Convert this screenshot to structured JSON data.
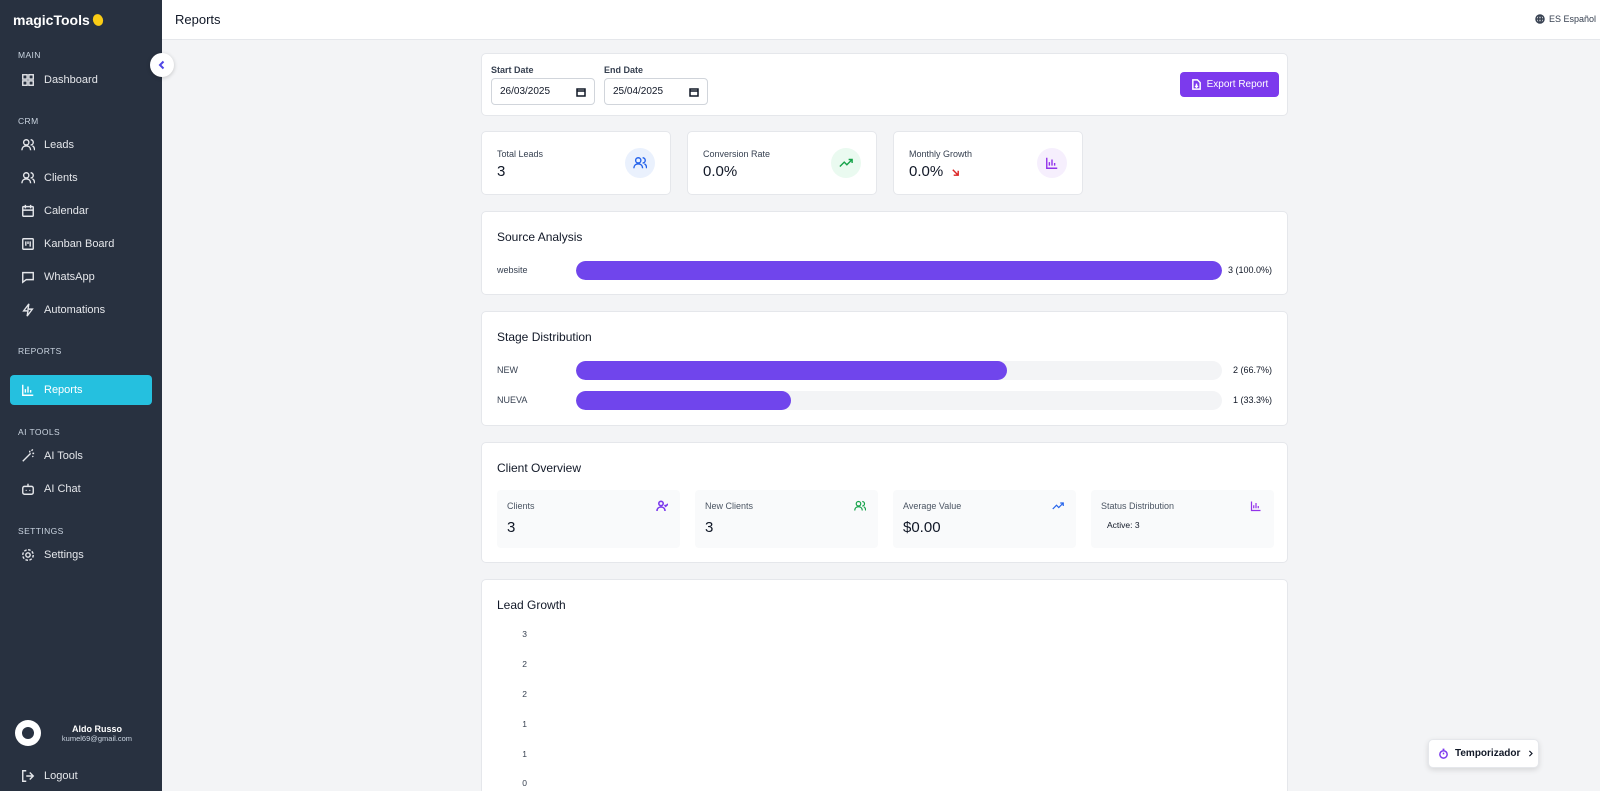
{
  "app": {
    "name": "magicTools"
  },
  "sidebar": {
    "sections": {
      "main": "MAIN",
      "crm": "CRM",
      "reports": "REPORTS",
      "ai_tools": "AI TOOLS",
      "settings": "SETTINGS"
    },
    "items": [
      {
        "label": "Dashboard",
        "icon": "dashboard-icon"
      },
      {
        "label": "Leads",
        "icon": "users-icon"
      },
      {
        "label": "Clients",
        "icon": "users-icon"
      },
      {
        "label": "Calendar",
        "icon": "calendar-icon"
      },
      {
        "label": "Kanban Board",
        "icon": "kanban-icon"
      },
      {
        "label": "WhatsApp",
        "icon": "message-icon"
      },
      {
        "label": "Automations",
        "icon": "zap-icon"
      },
      {
        "label": "Reports",
        "icon": "bar-chart-icon",
        "active": true
      },
      {
        "label": "AI Tools",
        "icon": "wand-icon"
      },
      {
        "label": "AI Chat",
        "icon": "bot-icon"
      },
      {
        "label": "Settings",
        "icon": "gear-icon"
      }
    ],
    "user": {
      "name": "Aldo Russo",
      "email": "kumel69@gmail.com"
    },
    "logout": "Logout"
  },
  "header": {
    "title": "Reports",
    "language": "ES Español"
  },
  "filters": {
    "start_label": "Start Date",
    "start_value": "26/03/2025",
    "end_label": "End Date",
    "end_value": "25/04/2025",
    "export_label": "Export Report"
  },
  "stats": [
    {
      "label": "Total Leads",
      "value": "3"
    },
    {
      "label": "Conversion Rate",
      "value": "0.0%"
    },
    {
      "label": "Monthly Growth",
      "value": "0.0%"
    }
  ],
  "source_analysis": {
    "title": "Source Analysis",
    "rows": [
      {
        "label": "website",
        "value": "3 (100.0%)",
        "fraction": 1.0
      }
    ]
  },
  "stage_distribution": {
    "title": "Stage Distribution",
    "rows": [
      {
        "label": "NEW",
        "value": "2 (66.7%)",
        "fraction": 0.667
      },
      {
        "label": "NUEVA",
        "value": "1 (33.3%)",
        "fraction": 0.333
      }
    ]
  },
  "client_overview": {
    "title": "Client Overview",
    "cards": [
      {
        "label": "Clients",
        "value": "3"
      },
      {
        "label": "New Clients",
        "value": "3"
      },
      {
        "label": "Average Value",
        "value": "$0.00"
      },
      {
        "label": "Status Distribution",
        "value": "Active: 3"
      }
    ]
  },
  "lead_growth": {
    "title": "Lead Growth",
    "y_ticks": [
      "3",
      "2",
      "2",
      "1",
      "1",
      "0"
    ]
  },
  "timer": {
    "label": "Temporizador"
  },
  "colors": {
    "sidebar": "#283140",
    "active": "#25c0df",
    "accent": "#7c3aed",
    "bar": "#7045ec"
  }
}
